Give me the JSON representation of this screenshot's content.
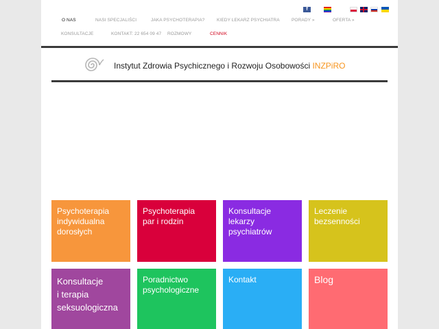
{
  "social": {
    "facebook_glyph": "f",
    "flags": [
      "flag-icon-rainbow",
      "flag-icon-pl",
      "flag-icon-en",
      "flag-icon-ru",
      "flag-icon-ua"
    ]
  },
  "nav": {
    "items": [
      {
        "label": "O NAS"
      },
      {
        "label": "NASI SPECJALIŚCI"
      },
      {
        "label": "JAKA PSYCHOTERAPIA?"
      },
      {
        "label": "KIEDY LEKARZ PSYCHIATRA"
      },
      {
        "label": "PORADY »"
      },
      {
        "label": "OFERTA »"
      },
      {
        "label": "KONSULTACJE"
      },
      {
        "label": "KONTAKT: 22 654 09 47"
      },
      {
        "label": "ROZMOWY"
      },
      {
        "label": "CENNIK"
      }
    ]
  },
  "brand": {
    "title": "Instytut Zdrowia Psychicznego i Rozwoju Osobowości",
    "accent": "INZPiRO",
    "accent_color": "#f7941d"
  },
  "tiles": [
    {
      "label": "Psychoterapia\nindywidualna\ndorosłych",
      "color": "#f7963c"
    },
    {
      "label": "Psychoterapia\npar i rodzin",
      "color": "#d9003b"
    },
    {
      "label": "Konsultacje\nlekarzy\npsychiatrów",
      "color": "#8a2be2"
    },
    {
      "label": "Leczenie\nbezsenności",
      "color": "#d6c31c"
    },
    {
      "label": "Konsultacje\ni terapia\nseksuologiczna",
      "color": "#a0479e"
    },
    {
      "label": "Poradnictwo\npsychologiczne",
      "color": "#1ec45e"
    },
    {
      "label": "Kontakt",
      "color": "#2aaef5"
    },
    {
      "label": "Blog",
      "color": "#ff6b72"
    }
  ]
}
